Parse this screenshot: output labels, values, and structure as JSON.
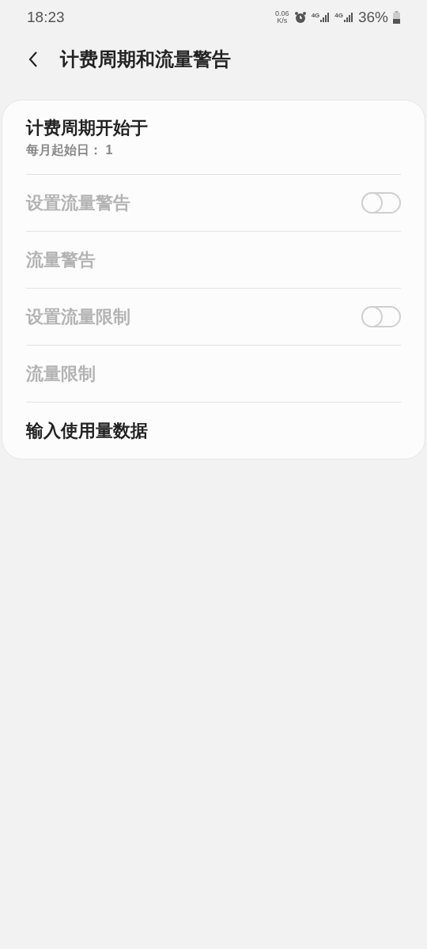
{
  "status_bar": {
    "time": "18:23",
    "speed": "0.06",
    "speed_unit": "K/s",
    "networks": [
      "4G",
      "4G"
    ],
    "battery": "36%"
  },
  "header": {
    "title": "计费周期和流量警告"
  },
  "items": [
    {
      "kind": "text",
      "title": "计费周期开始于",
      "subtitle": "每月起始日： 1",
      "disabled": false
    },
    {
      "kind": "switch",
      "title": "设置流量警告",
      "disabled": true,
      "on": false
    },
    {
      "kind": "text",
      "title": "流量警告",
      "disabled": true
    },
    {
      "kind": "switch",
      "title": "设置流量限制",
      "disabled": true,
      "on": false
    },
    {
      "kind": "text",
      "title": "流量限制",
      "disabled": true
    },
    {
      "kind": "text",
      "title": "输入使用量数据",
      "disabled": false
    }
  ]
}
